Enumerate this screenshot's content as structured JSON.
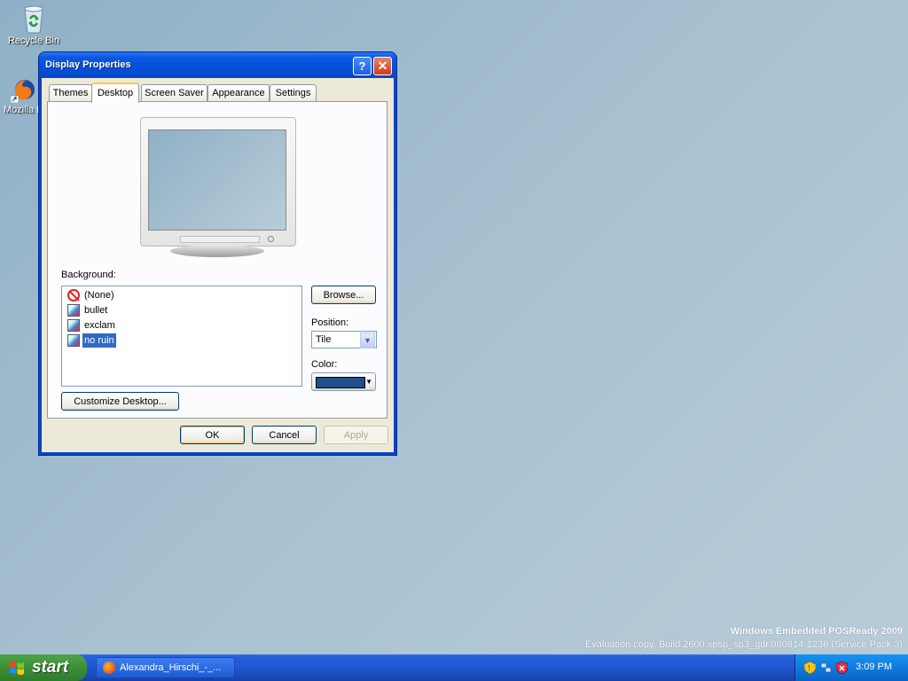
{
  "desktop": {
    "icons": [
      {
        "label": "Recycle Bin",
        "icon": "recycle-bin-icon"
      },
      {
        "label": "Mozilla F",
        "icon": "firefox-icon"
      }
    ],
    "watermark": {
      "line1": "Windows Embedded POSReady 2009",
      "line2": "Evaluation copy. Build 2600.xpsp_sp3_gdr.080814-1236 (Service Pack 3)"
    }
  },
  "dialog": {
    "title": "Display Properties",
    "help_glyph": "?",
    "close_glyph": "✕",
    "tabs": [
      {
        "label": "Themes",
        "active": false
      },
      {
        "label": "Desktop",
        "active": true
      },
      {
        "label": "Screen Saver",
        "active": false
      },
      {
        "label": "Appearance",
        "active": false
      },
      {
        "label": "Settings",
        "active": false
      }
    ],
    "background_label": "Background:",
    "background_items": [
      {
        "label": "(None)",
        "icon": "none-icon",
        "selected": false
      },
      {
        "label": "bullet",
        "icon": "image-file-icon",
        "selected": false
      },
      {
        "label": "exclam",
        "icon": "image-file-icon",
        "selected": false
      },
      {
        "label": "no ruin",
        "icon": "image-file-icon",
        "selected": true
      }
    ],
    "browse_label": "Browse...",
    "position_label": "Position:",
    "position_value": "Tile",
    "color_label": "Color:",
    "color_value": "#1f4e8c",
    "customize_label": "Customize Desktop...",
    "ok_label": "OK",
    "cancel_label": "Cancel",
    "apply_label": "Apply"
  },
  "taskbar": {
    "start_label": "start",
    "task_label": "Alexandra_Hirschi_-_...",
    "clock": "3:09 PM"
  }
}
